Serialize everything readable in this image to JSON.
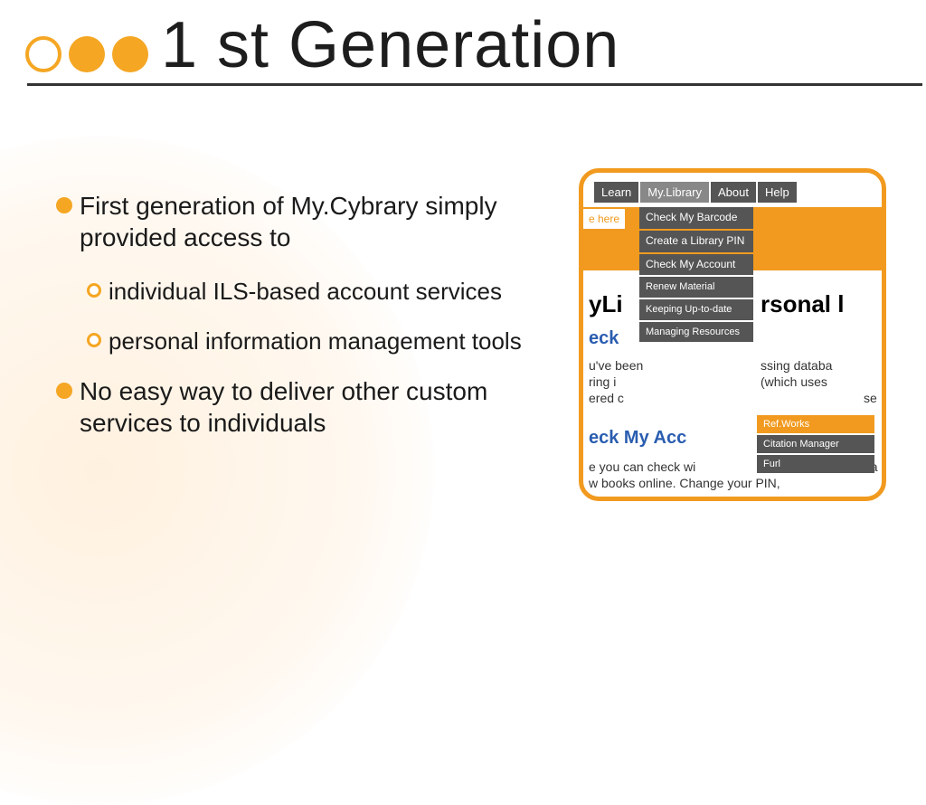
{
  "title": "1 st Generation",
  "bullets": {
    "b1": "First generation of My.Cybrary simply provided access to",
    "b1a": "individual ILS-based account services",
    "b1b": "personal information management tools",
    "b2": "No easy way to deliver other custom services to individuals"
  },
  "figure": {
    "tabs": {
      "learn": "Learn",
      "mylib": "My.Library",
      "about": "About",
      "help": "Help"
    },
    "here": "e here",
    "menu": {
      "check_barcode": "Check My Barcode",
      "create_pin": "Create a Library PIN",
      "check_account": "Check My Account",
      "renew": "Renew Material",
      "uptodate": "Keeping Up-to-date",
      "managing": "Managing Resources"
    },
    "submenu": {
      "refworks": "Ref.Works",
      "citation": "Citation Manager",
      "furl": "Furl"
    },
    "bg": {
      "heading": "yLi",
      "heading2": "rsonal l",
      "eck": "eck",
      "check_acc": "eck My Acc",
      "para1": "u've been",
      "para1b": "ssing databa",
      "para2": "ring i",
      "para2b": "(which uses",
      "para3": "ered c",
      "para3b": "se",
      "para4": "e you can check wi",
      "para4b": "na",
      "para5": "w books online. Change your PIN,"
    }
  }
}
